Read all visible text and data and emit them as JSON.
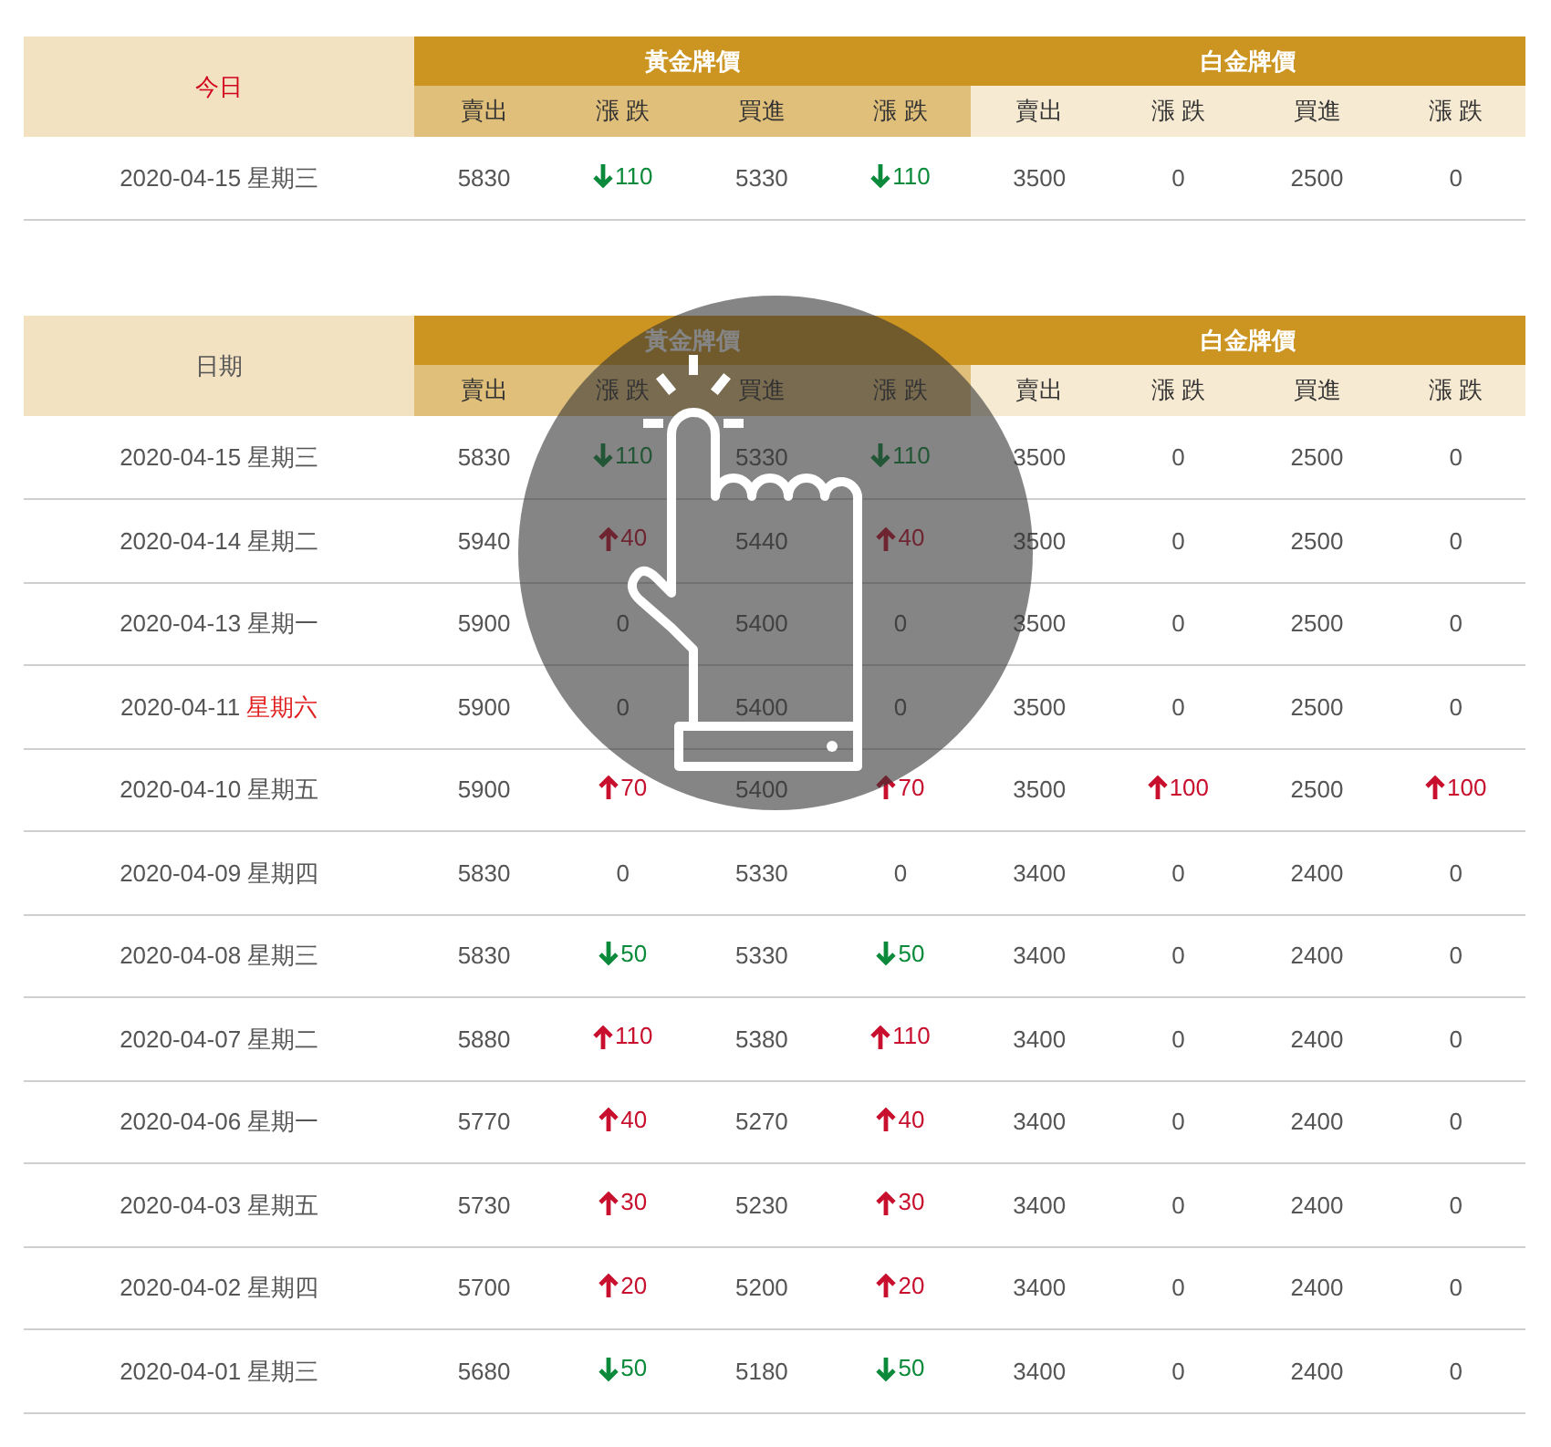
{
  "today_table": {
    "date_header": "今日",
    "groups": [
      {
        "label": "黃金牌價",
        "columns": [
          "賣出",
          "漲 跌",
          "買進",
          "漲 跌"
        ]
      },
      {
        "label": "白金牌價",
        "columns": [
          "賣出",
          "漲 跌",
          "買進",
          "漲 跌"
        ]
      }
    ],
    "rows": [
      {
        "date": "2020-04-15",
        "weekday": "星期三",
        "weekend": false,
        "cells": [
          {
            "kind": "price",
            "value": "5830"
          },
          {
            "kind": "down",
            "value": "110"
          },
          {
            "kind": "price",
            "value": "5330"
          },
          {
            "kind": "down",
            "value": "110"
          },
          {
            "kind": "price",
            "value": "3500"
          },
          {
            "kind": "flat",
            "value": "0"
          },
          {
            "kind": "price",
            "value": "2500"
          },
          {
            "kind": "flat",
            "value": "0"
          }
        ]
      }
    ]
  },
  "history_table": {
    "date_header": "日期",
    "groups": [
      {
        "label": "黃金牌價",
        "columns": [
          "賣出",
          "漲 跌",
          "買進",
          "漲 跌"
        ]
      },
      {
        "label": "白金牌價",
        "columns": [
          "賣出",
          "漲 跌",
          "買進",
          "漲 跌"
        ]
      }
    ],
    "rows": [
      {
        "date": "2020-04-15",
        "weekday": "星期三",
        "weekend": false,
        "cells": [
          {
            "kind": "price",
            "value": "5830"
          },
          {
            "kind": "down",
            "value": "110"
          },
          {
            "kind": "price",
            "value": "5330"
          },
          {
            "kind": "down",
            "value": "110"
          },
          {
            "kind": "price",
            "value": "3500"
          },
          {
            "kind": "flat",
            "value": "0"
          },
          {
            "kind": "price",
            "value": "2500"
          },
          {
            "kind": "flat",
            "value": "0"
          }
        ]
      },
      {
        "date": "2020-04-14",
        "weekday": "星期二",
        "weekend": false,
        "cells": [
          {
            "kind": "price",
            "value": "5940"
          },
          {
            "kind": "up",
            "value": "40"
          },
          {
            "kind": "price",
            "value": "5440"
          },
          {
            "kind": "up",
            "value": "40"
          },
          {
            "kind": "price",
            "value": "3500"
          },
          {
            "kind": "flat",
            "value": "0"
          },
          {
            "kind": "price",
            "value": "2500"
          },
          {
            "kind": "flat",
            "value": "0"
          }
        ]
      },
      {
        "date": "2020-04-13",
        "weekday": "星期一",
        "weekend": false,
        "cells": [
          {
            "kind": "price",
            "value": "5900"
          },
          {
            "kind": "flat",
            "value": "0"
          },
          {
            "kind": "price",
            "value": "5400"
          },
          {
            "kind": "flat",
            "value": "0"
          },
          {
            "kind": "price",
            "value": "3500"
          },
          {
            "kind": "flat",
            "value": "0"
          },
          {
            "kind": "price",
            "value": "2500"
          },
          {
            "kind": "flat",
            "value": "0"
          }
        ]
      },
      {
        "date": "2020-04-11",
        "weekday": "星期六",
        "weekend": true,
        "cells": [
          {
            "kind": "price",
            "value": "5900"
          },
          {
            "kind": "flat",
            "value": "0"
          },
          {
            "kind": "price",
            "value": "5400"
          },
          {
            "kind": "flat",
            "value": "0"
          },
          {
            "kind": "price",
            "value": "3500"
          },
          {
            "kind": "flat",
            "value": "0"
          },
          {
            "kind": "price",
            "value": "2500"
          },
          {
            "kind": "flat",
            "value": "0"
          }
        ]
      },
      {
        "date": "2020-04-10",
        "weekday": "星期五",
        "weekend": false,
        "cells": [
          {
            "kind": "price",
            "value": "5900"
          },
          {
            "kind": "up",
            "value": "70"
          },
          {
            "kind": "price",
            "value": "5400"
          },
          {
            "kind": "up",
            "value": "70"
          },
          {
            "kind": "price",
            "value": "3500"
          },
          {
            "kind": "up",
            "value": "100"
          },
          {
            "kind": "price",
            "value": "2500"
          },
          {
            "kind": "up",
            "value": "100"
          }
        ]
      },
      {
        "date": "2020-04-09",
        "weekday": "星期四",
        "weekend": false,
        "cells": [
          {
            "kind": "price",
            "value": "5830"
          },
          {
            "kind": "flat",
            "value": "0"
          },
          {
            "kind": "price",
            "value": "5330"
          },
          {
            "kind": "flat",
            "value": "0"
          },
          {
            "kind": "price",
            "value": "3400"
          },
          {
            "kind": "flat",
            "value": "0"
          },
          {
            "kind": "price",
            "value": "2400"
          },
          {
            "kind": "flat",
            "value": "0"
          }
        ]
      },
      {
        "date": "2020-04-08",
        "weekday": "星期三",
        "weekend": false,
        "cells": [
          {
            "kind": "price",
            "value": "5830"
          },
          {
            "kind": "down",
            "value": "50"
          },
          {
            "kind": "price",
            "value": "5330"
          },
          {
            "kind": "down",
            "value": "50"
          },
          {
            "kind": "price",
            "value": "3400"
          },
          {
            "kind": "flat",
            "value": "0"
          },
          {
            "kind": "price",
            "value": "2400"
          },
          {
            "kind": "flat",
            "value": "0"
          }
        ]
      },
      {
        "date": "2020-04-07",
        "weekday": "星期二",
        "weekend": false,
        "cells": [
          {
            "kind": "price",
            "value": "5880"
          },
          {
            "kind": "up",
            "value": "110"
          },
          {
            "kind": "price",
            "value": "5380"
          },
          {
            "kind": "up",
            "value": "110"
          },
          {
            "kind": "price",
            "value": "3400"
          },
          {
            "kind": "flat",
            "value": "0"
          },
          {
            "kind": "price",
            "value": "2400"
          },
          {
            "kind": "flat",
            "value": "0"
          }
        ]
      },
      {
        "date": "2020-04-06",
        "weekday": "星期一",
        "weekend": false,
        "cells": [
          {
            "kind": "price",
            "value": "5770"
          },
          {
            "kind": "up",
            "value": "40"
          },
          {
            "kind": "price",
            "value": "5270"
          },
          {
            "kind": "up",
            "value": "40"
          },
          {
            "kind": "price",
            "value": "3400"
          },
          {
            "kind": "flat",
            "value": "0"
          },
          {
            "kind": "price",
            "value": "2400"
          },
          {
            "kind": "flat",
            "value": "0"
          }
        ]
      },
      {
        "date": "2020-04-03",
        "weekday": "星期五",
        "weekend": false,
        "cells": [
          {
            "kind": "price",
            "value": "5730"
          },
          {
            "kind": "up",
            "value": "30"
          },
          {
            "kind": "price",
            "value": "5230"
          },
          {
            "kind": "up",
            "value": "30"
          },
          {
            "kind": "price",
            "value": "3400"
          },
          {
            "kind": "flat",
            "value": "0"
          },
          {
            "kind": "price",
            "value": "2400"
          },
          {
            "kind": "flat",
            "value": "0"
          }
        ]
      },
      {
        "date": "2020-04-02",
        "weekday": "星期四",
        "weekend": false,
        "cells": [
          {
            "kind": "price",
            "value": "5700"
          },
          {
            "kind": "up",
            "value": "20"
          },
          {
            "kind": "price",
            "value": "5200"
          },
          {
            "kind": "up",
            "value": "20"
          },
          {
            "kind": "price",
            "value": "3400"
          },
          {
            "kind": "flat",
            "value": "0"
          },
          {
            "kind": "price",
            "value": "2400"
          },
          {
            "kind": "flat",
            "value": "0"
          }
        ]
      },
      {
        "date": "2020-04-01",
        "weekday": "星期三",
        "weekend": false,
        "cells": [
          {
            "kind": "price",
            "value": "5680"
          },
          {
            "kind": "down",
            "value": "50"
          },
          {
            "kind": "price",
            "value": "5180"
          },
          {
            "kind": "down",
            "value": "50"
          },
          {
            "kind": "price",
            "value": "3400"
          },
          {
            "kind": "flat",
            "value": "0"
          },
          {
            "kind": "price",
            "value": "2400"
          },
          {
            "kind": "flat",
            "value": "0"
          }
        ]
      }
    ]
  }
}
